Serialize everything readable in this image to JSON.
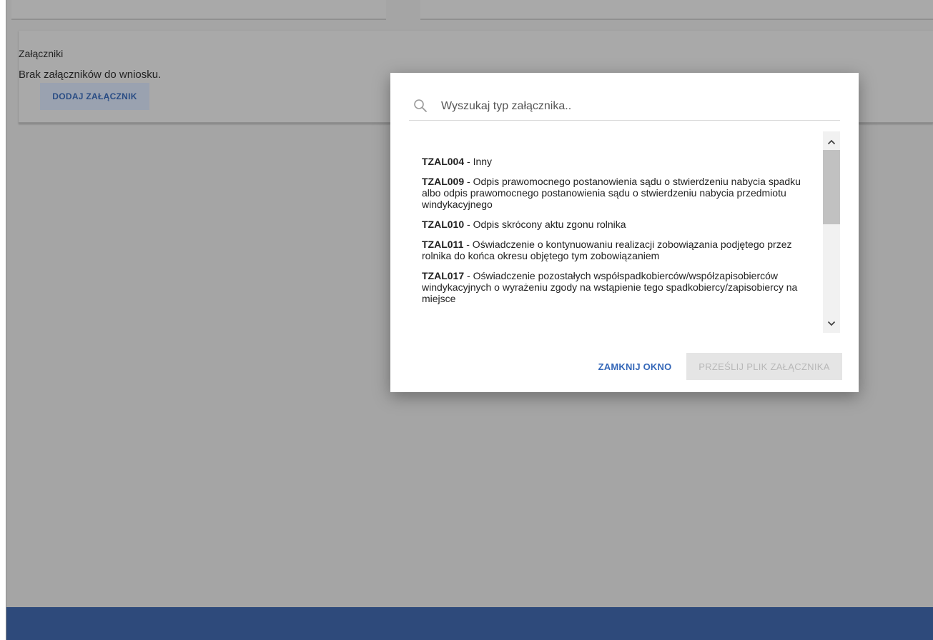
{
  "attachments": {
    "title": "Załączniki",
    "empty_message": "Brak załączników do wniosku.",
    "add_button_label": "DODAJ ZAŁĄCZNIK"
  },
  "modal": {
    "search_placeholder": "Wyszukaj typ załącznika..",
    "search_icon": "search-icon",
    "items": [
      {
        "code": "TZAL004",
        "desc": " - Inny"
      },
      {
        "code": "TZAL009",
        "desc": " - Odpis prawomocnego postanowienia sądu o stwierdzeniu nabycia spadku albo odpis prawomocnego postanowienia sądu o stwierdzeniu nabycia przedmiotu windykacyjnego"
      },
      {
        "code": "TZAL010",
        "desc": " - Odpis skrócony aktu zgonu rolnika"
      },
      {
        "code": "TZAL011",
        "desc": " - Oświadczenie o kontynuowaniu realizacji zobowiązania podjętego przez rolnika do końca okresu objętego tym zobowiązaniem"
      },
      {
        "code": "TZAL017",
        "desc": " - Oświadczenie pozostałych współspadkobierców/współzapisobierców windykacyjnych o wyrażeniu zgody na wstąpienie tego spadkobiercy/zapisobiercy na miejsce"
      }
    ],
    "close_label": "ZAMKNIJ OKNO",
    "upload_label": "PRZEŚLIJ PLIK ZAŁĄCZNIKA"
  },
  "colors": {
    "overlay": "#a5a5a5",
    "footer": "#2e4a7b",
    "accent_link": "#3467b8",
    "disabled_button_bg": "#e5e5e5"
  }
}
